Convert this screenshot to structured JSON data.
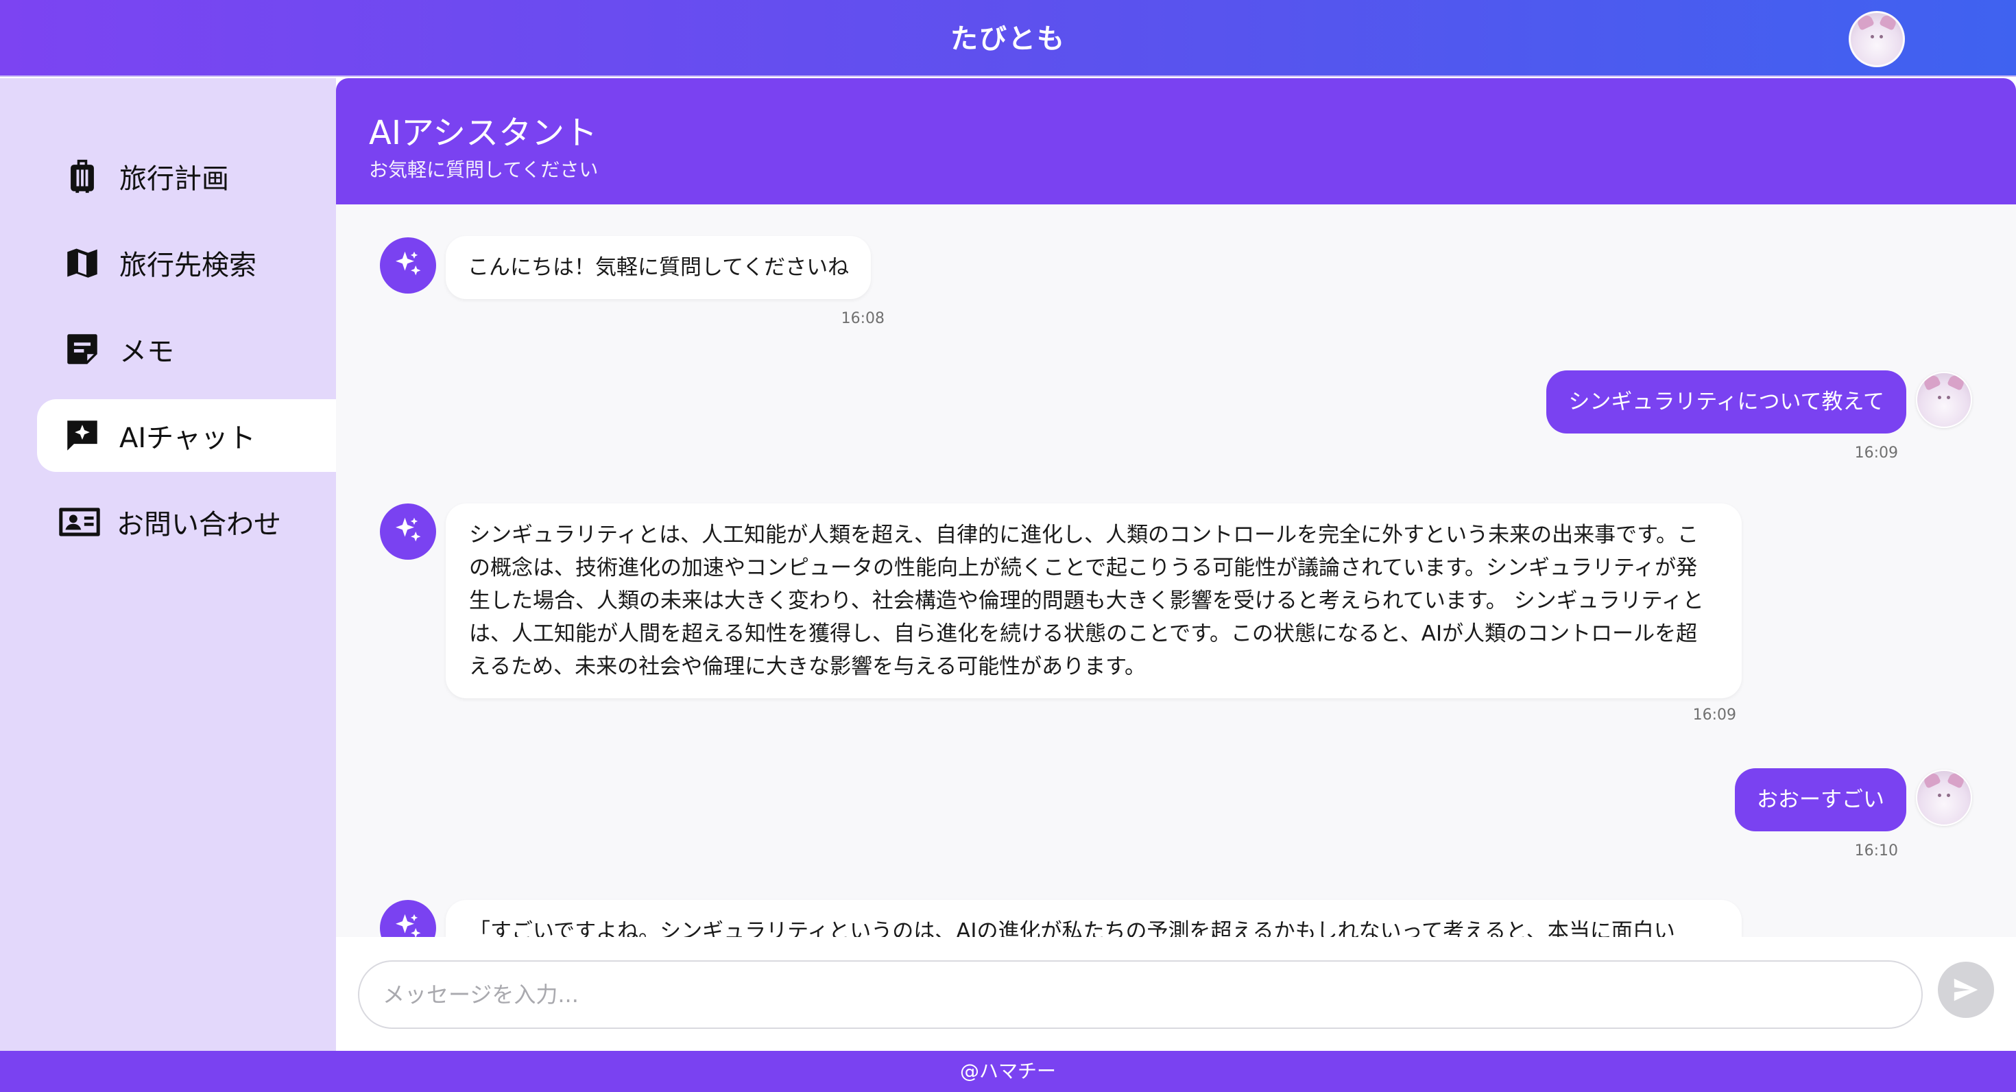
{
  "app": {
    "title": "たびとも"
  },
  "colors": {
    "accent": "#7a42f1",
    "sidebar_bg": "#e3d8fb",
    "chat_bg": "#f8f8fa"
  },
  "sidebar": {
    "items": [
      {
        "label": "旅行計画",
        "icon": "luggage-icon"
      },
      {
        "label": "旅行先検索",
        "icon": "map-icon"
      },
      {
        "label": "メモ",
        "icon": "note-icon"
      },
      {
        "label": "AIチャット",
        "icon": "ai-chat-icon",
        "active": true
      },
      {
        "label": "お問い合わせ",
        "icon": "contact-card-icon"
      }
    ]
  },
  "chat": {
    "title": "AIアシスタント",
    "subtitle": "お気軽に質問してください",
    "messages": [
      {
        "role": "assistant",
        "text": "こんにちは！気軽に質問してくださいね",
        "time": "16:08"
      },
      {
        "role": "user",
        "text": "シンギュラリティについて教えて",
        "time": "16:09"
      },
      {
        "role": "assistant",
        "text": "シンギュラリティとは、人工知能が人類を超え、自律的に進化し、人類のコントロールを完全に外すという未来の出来事です。この概念は、技術進化の加速やコンピュータの性能向上が続くことで起こりうる可能性が議論されています。シンギュラリティが発生した場合、人類の未来は大きく変わり、社会構造や倫理的問題も大きく影響を受けると考えられています。 シンギュラリティとは、人工知能が人間を超える知性を獲得し、自ら進化を続ける状態のことです。この状態になると、AIが人類のコントロールを超えるため、未来の社会や倫理に大きな影響を与える可能性があります。",
        "time": "16:09"
      },
      {
        "role": "user",
        "text": "おおーすごい",
        "time": "16:10"
      },
      {
        "role": "assistant",
        "text": "「すごいですよね。シンギュラリティというのは、AIの進化が私たちの予測を超えるかもしれないって考えると、本当に面白い"
      }
    ]
  },
  "input": {
    "placeholder": "メッセージを入力..."
  },
  "footer": {
    "text": "@ハマチー"
  }
}
